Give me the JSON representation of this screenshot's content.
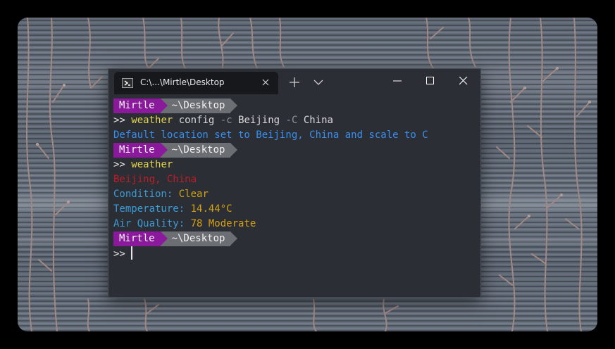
{
  "window": {
    "tab_title": "C:\\...\\Mirtle\\Desktop"
  },
  "icons": {
    "tab": "powershell-icon",
    "tab_close": "close-icon",
    "new_tab": "plus-icon",
    "dropdown": "chevron-down-icon",
    "minimize": "minimize-icon",
    "maximize": "maximize-icon",
    "close": "close-icon"
  },
  "colors": {
    "prompt_user_bg": "#8a1a9b",
    "prompt_path_bg": "#6b6e72",
    "command": "#e6d84a",
    "info_blue": "#3b8eea",
    "location_red": "#c01c28",
    "label_blue": "#3b9bd6",
    "value_gold": "#d4a017"
  },
  "prompt": {
    "user": "Mirtle",
    "path": "~\\Desktop",
    "symbol": ">>"
  },
  "terminal": {
    "cmd1": {
      "command": "weather",
      "a1": "config",
      "f1": "-c",
      "a2": "Beijing",
      "f2": "-C",
      "a3": "China"
    },
    "out1": "Default location set to Beijing, China and scale to C",
    "cmd2": {
      "command": "weather"
    },
    "location": "Beijing, China",
    "condition": {
      "label": "Condition:",
      "value": "Clear"
    },
    "temperature": {
      "label": "Temperature:",
      "value": "14.44°C"
    },
    "air_quality": {
      "label": "Air Quality:",
      "value": "78 Moderate"
    }
  }
}
